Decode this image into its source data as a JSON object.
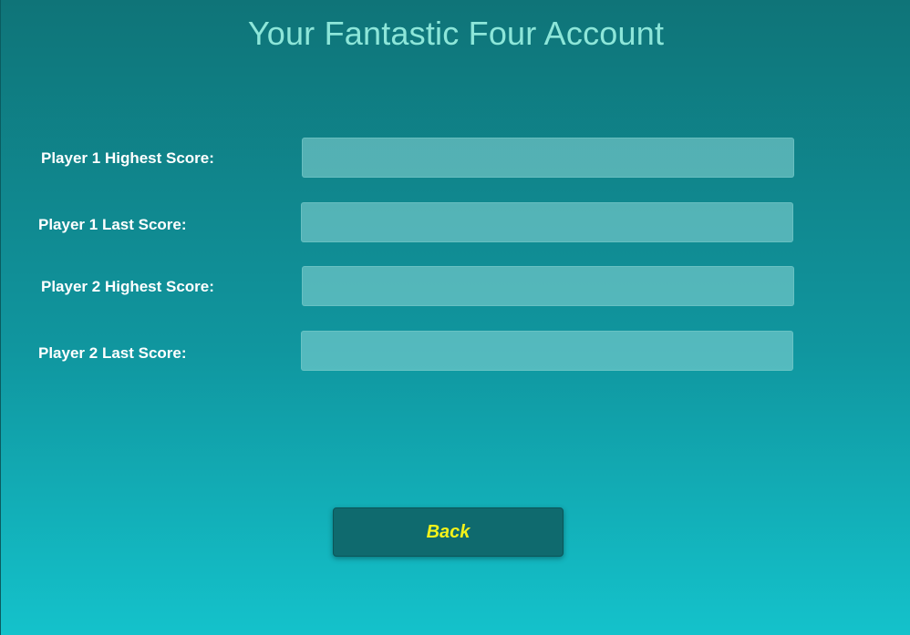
{
  "header": {
    "title": "Your Fantastic Four Account"
  },
  "fields": [
    {
      "label": "Player 1 Highest Score:",
      "value": ""
    },
    {
      "label": "Player 1 Last Score:",
      "value": ""
    },
    {
      "label": "Player 2 Highest Score:",
      "value": ""
    },
    {
      "label": "Player 2 Last Score:",
      "value": ""
    }
  ],
  "actions": {
    "back_label": "Back"
  },
  "colors": {
    "title": "#8de6d9",
    "label": "#ffffff",
    "button_text": "#f2f21a",
    "button_bg": "#0f6a6e"
  }
}
